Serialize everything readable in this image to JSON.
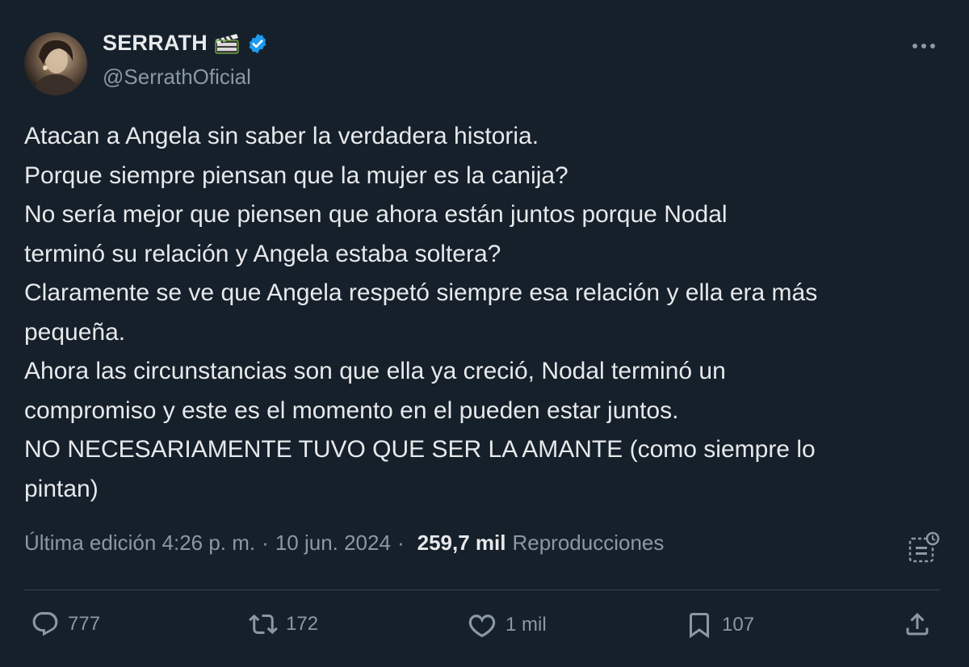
{
  "author": {
    "display_name": "SERRATH",
    "handle": "@SerrathOficial",
    "name_emoji_icon": "clapper-board-icon",
    "verified_icon": "verified-badge-icon",
    "verified_color": "#1d9bf0"
  },
  "tweet": {
    "lines": [
      "Atacan a Angela sin saber la verdadera historia.",
      "Porque siempre piensan que la mujer es la canija?",
      "No sería mejor que piensen que ahora están juntos porque Nodal",
      "terminó su relación y Angela estaba soltera?",
      "Claramente se ve que Angela respetó siempre esa relación y ella era más",
      "pequeña.",
      "Ahora las circunstancias son que ella ya creció, Nodal terminó un",
      "compromiso y este es el momento en el pueden estar juntos.",
      "NO NECESARIAMENTE TUVO QUE SER LA AMANTE (como siempre lo",
      "pintan)"
    ]
  },
  "meta": {
    "edited_label": "Última edición 4:26 p. m.",
    "separator": "·",
    "date": "10 jun. 2024",
    "views_count": "259,7 mil",
    "views_label": "Reproducciones"
  },
  "actions": {
    "replies": "777",
    "reposts": "172",
    "likes": "1 mil",
    "bookmarks": "107"
  },
  "colors": {
    "background": "#15202b",
    "text": "#e7e9ea",
    "secondary": "#8b98a5",
    "divider": "#38444d"
  }
}
